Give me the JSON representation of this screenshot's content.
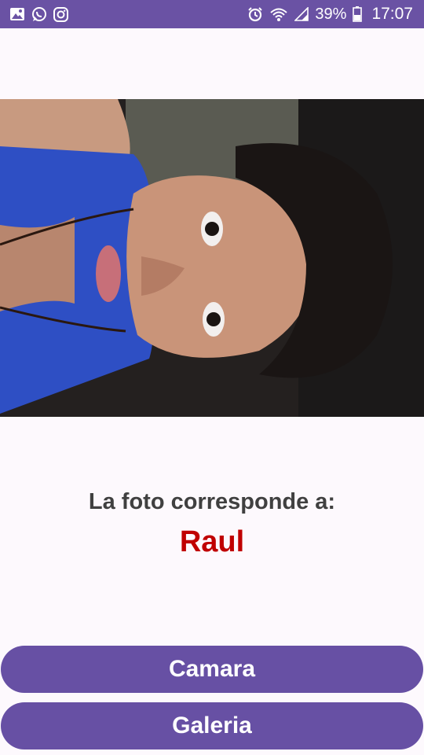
{
  "status_bar": {
    "left_icons": [
      "gallery-icon",
      "whatsapp-icon",
      "instagram-icon"
    ],
    "right_icons": [
      "alarm-icon",
      "wifi-icon",
      "signal-icon",
      "battery-icon"
    ],
    "battery_percent": "39%",
    "time": "17:07",
    "background_color": "#6a52a4"
  },
  "result": {
    "caption": "La foto corresponde a:",
    "name": "Raul",
    "name_color": "#c00000"
  },
  "buttons": {
    "camera_label": "Camara",
    "gallery_label": "Galeria",
    "color": "#6750a4"
  }
}
